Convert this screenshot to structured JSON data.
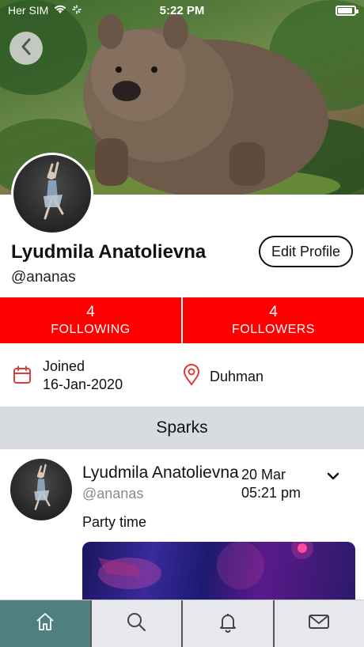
{
  "status_bar": {
    "carrier": "Her SIM",
    "time": "5:22 PM"
  },
  "profile": {
    "name": "Lyudmila Anatolievna",
    "handle": "@ananas",
    "edit_label": "Edit Profile"
  },
  "stats": [
    {
      "count": "4",
      "label": "FOLLOWING"
    },
    {
      "count": "4",
      "label": "FOLLOWERS"
    }
  ],
  "info": {
    "joined_label": "Joined",
    "joined_date": "16-Jan-2020",
    "location": "Duhman"
  },
  "sparks": {
    "header": "Sparks",
    "posts": [
      {
        "name": "Lyudmila Anatolievna",
        "handle": "@ananas",
        "date": "20 Mar",
        "time": "05:21 pm",
        "text": "Party time"
      }
    ]
  },
  "tabs": [
    "home-icon",
    "search-icon",
    "bell-icon",
    "mail-icon"
  ],
  "colors": {
    "accent": "#ff0000",
    "active_tab": "#4f7f7f",
    "section_bg": "#d8dbe0"
  }
}
